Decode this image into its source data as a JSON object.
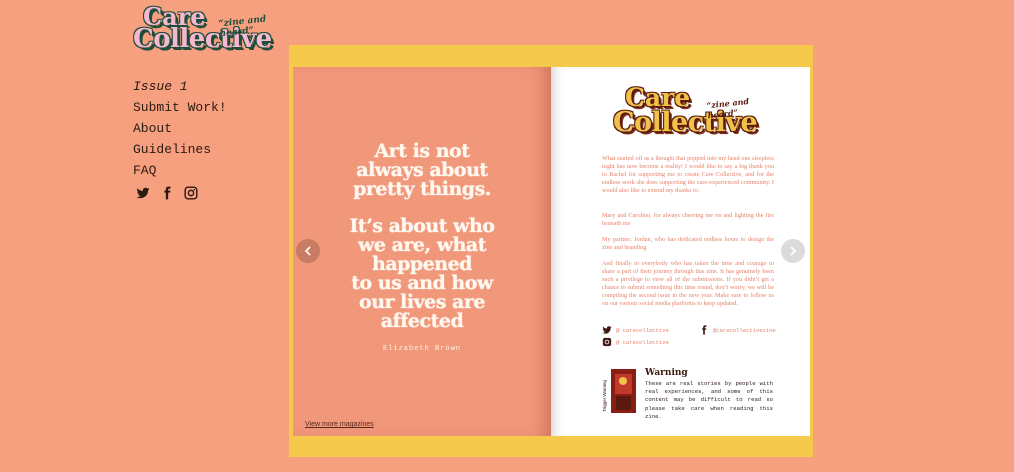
{
  "site": {
    "logo": {
      "line1": "Care",
      "line2": "Collective",
      "tagline": "“zine and heard”"
    },
    "nav": [
      {
        "label": "Issue 1",
        "current": true
      },
      {
        "label": "Submit Work!"
      },
      {
        "label": "About"
      },
      {
        "label": "Guidelines"
      },
      {
        "label": "FAQ"
      }
    ],
    "social_icons": [
      "twitter-icon",
      "facebook-icon",
      "instagram-icon"
    ]
  },
  "magazine": {
    "left_page": {
      "quote_part1": [
        "Art is not",
        "always about",
        "pretty things."
      ],
      "quote_part2": [
        "It’s about who",
        "we are, what",
        "happened",
        "to us and how",
        "our lives are",
        "affected"
      ],
      "author": "Elizabeth Brown",
      "more_link": "View more magazines"
    },
    "right_page": {
      "logo": {
        "line1": "Care",
        "line2": "Collective",
        "tagline": "“zine and heard”"
      },
      "paragraphs": [
        "What started off as a thought that popped into my head one sleepless night has now become a reality! I would like to say a big thank you to Rachel for supporting me to create Care Collective, and for the endless work she does supporting the care-experienced community. I would also like to extend my thanks to:",
        "Mary and Caroline, for always cheering me on and lighting the fire beneath me",
        "My partner, Jordan, who has dedicated endless hours to design the zine and branding",
        "And finally to everybody who has taken the time and courage to share a part of their journey through this zine. It has genuinely been such a privilege to view all of the submissions. If you didn’t get a chance to submit something this time round, don’t worry, we will be compiling the second issue in the new year. Make sure to follow us on our various social media platforms to keep updated."
      ],
      "social": {
        "twitter": "@ carecollective",
        "facebook": "@carecollectivezine",
        "instagram": "@ carecollective"
      },
      "warning": {
        "side_label": "Trigger Warning",
        "title": "Warning",
        "text": "These are real stories by people with real experiences, and some of this content may be difficult to read so please take care when reading this zine."
      }
    }
  },
  "colors": {
    "background": "#f7a07f",
    "frame": "#f5c94b",
    "left_page": "#f1977a",
    "text_pink": "#e7826a",
    "logo_green": "#1f4d3a"
  }
}
